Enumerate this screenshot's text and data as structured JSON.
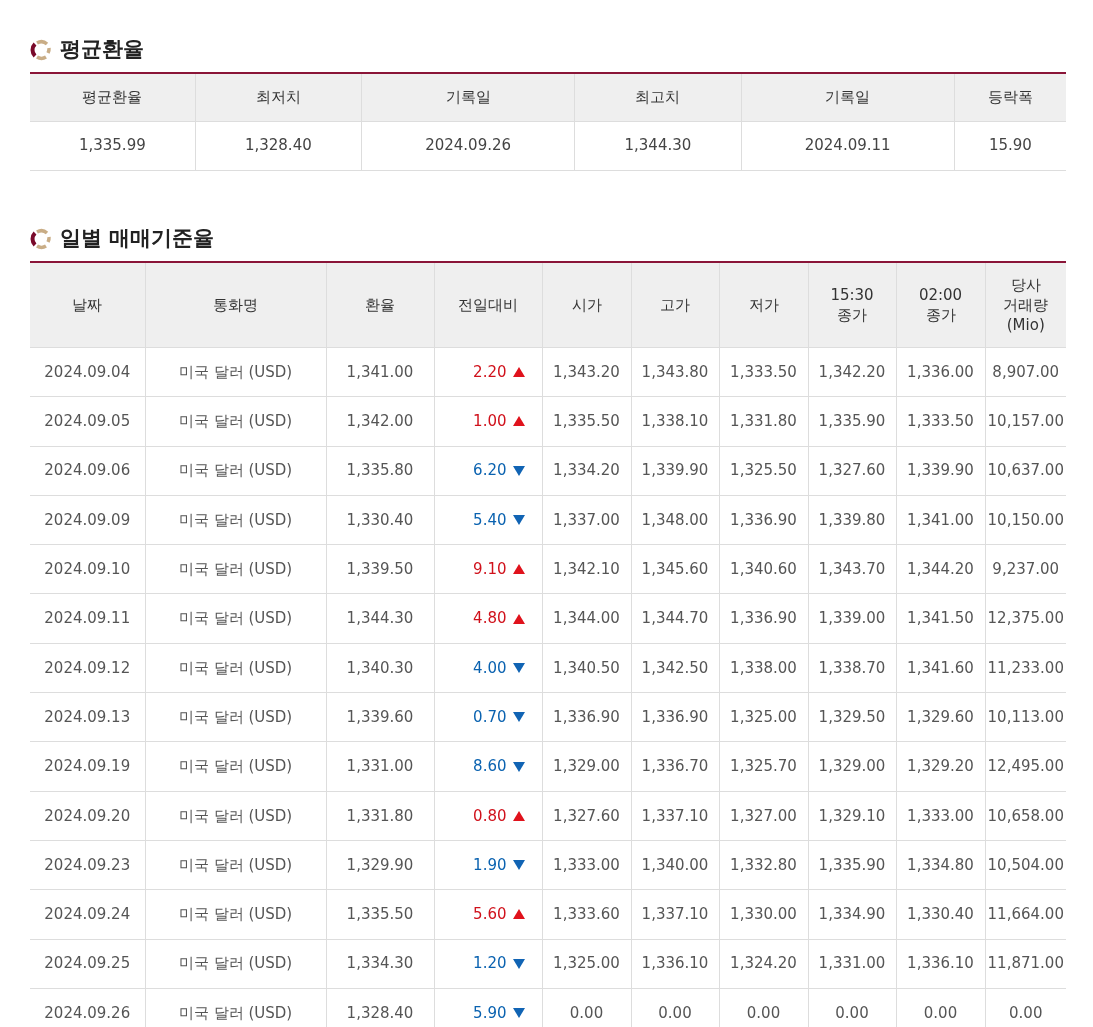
{
  "average_section": {
    "title": "평균환율",
    "columns": [
      "평균환율",
      "최저치",
      "기록일",
      "최고치",
      "기록일",
      "등락폭"
    ],
    "row": [
      "1,335.99",
      "1,328.40",
      "2024.09.26",
      "1,344.30",
      "2024.09.11",
      "15.90"
    ]
  },
  "daily_section": {
    "title": "일별 매매기준율",
    "columns": [
      "날짜",
      "통화명",
      "환율",
      "전일대비",
      "시가",
      "고가",
      "저가",
      "15:30\n종가",
      "02:00\n종가",
      "당사\n거래량\n(Mio)"
    ],
    "rows": [
      {
        "date": "2024.09.04",
        "currency": "미국 달러 (USD)",
        "rate": "1,341.00",
        "change": "2.20",
        "kind": "up",
        "open": "1,343.20",
        "high": "1,343.80",
        "low": "1,333.50",
        "close_1530": "1,342.20",
        "close_0200": "1,336.00",
        "volume": "8,907.00"
      },
      {
        "date": "2024.09.05",
        "currency": "미국 달러 (USD)",
        "rate": "1,342.00",
        "change": "1.00",
        "kind": "up",
        "open": "1,335.50",
        "high": "1,338.10",
        "low": "1,331.80",
        "close_1530": "1,335.90",
        "close_0200": "1,333.50",
        "volume": "10,157.00"
      },
      {
        "date": "2024.09.06",
        "currency": "미국 달러 (USD)",
        "rate": "1,335.80",
        "change": "6.20",
        "kind": "down",
        "open": "1,334.20",
        "high": "1,339.90",
        "low": "1,325.50",
        "close_1530": "1,327.60",
        "close_0200": "1,339.90",
        "volume": "10,637.00"
      },
      {
        "date": "2024.09.09",
        "currency": "미국 달러 (USD)",
        "rate": "1,330.40",
        "change": "5.40",
        "kind": "down",
        "open": "1,337.00",
        "high": "1,348.00",
        "low": "1,336.90",
        "close_1530": "1,339.80",
        "close_0200": "1,341.00",
        "volume": "10,150.00"
      },
      {
        "date": "2024.09.10",
        "currency": "미국 달러 (USD)",
        "rate": "1,339.50",
        "change": "9.10",
        "kind": "up",
        "open": "1,342.10",
        "high": "1,345.60",
        "low": "1,340.60",
        "close_1530": "1,343.70",
        "close_0200": "1,344.20",
        "volume": "9,237.00"
      },
      {
        "date": "2024.09.11",
        "currency": "미국 달러 (USD)",
        "rate": "1,344.30",
        "change": "4.80",
        "kind": "up",
        "open": "1,344.00",
        "high": "1,344.70",
        "low": "1,336.90",
        "close_1530": "1,339.00",
        "close_0200": "1,341.50",
        "volume": "12,375.00"
      },
      {
        "date": "2024.09.12",
        "currency": "미국 달러 (USD)",
        "rate": "1,340.30",
        "change": "4.00",
        "kind": "down",
        "open": "1,340.50",
        "high": "1,342.50",
        "low": "1,338.00",
        "close_1530": "1,338.70",
        "close_0200": "1,341.60",
        "volume": "11,233.00"
      },
      {
        "date": "2024.09.13",
        "currency": "미국 달러 (USD)",
        "rate": "1,339.60",
        "change": "0.70",
        "kind": "down",
        "open": "1,336.90",
        "high": "1,336.90",
        "low": "1,325.00",
        "close_1530": "1,329.50",
        "close_0200": "1,329.60",
        "volume": "10,113.00"
      },
      {
        "date": "2024.09.19",
        "currency": "미국 달러 (USD)",
        "rate": "1,331.00",
        "change": "8.60",
        "kind": "down",
        "open": "1,329.00",
        "high": "1,336.70",
        "low": "1,325.70",
        "close_1530": "1,329.00",
        "close_0200": "1,329.20",
        "volume": "12,495.00"
      },
      {
        "date": "2024.09.20",
        "currency": "미국 달러 (USD)",
        "rate": "1,331.80",
        "change": "0.80",
        "kind": "up",
        "open": "1,327.60",
        "high": "1,337.10",
        "low": "1,327.00",
        "close_1530": "1,329.10",
        "close_0200": "1,333.00",
        "volume": "10,658.00"
      },
      {
        "date": "2024.09.23",
        "currency": "미국 달러 (USD)",
        "rate": "1,329.90",
        "change": "1.90",
        "kind": "down",
        "open": "1,333.00",
        "high": "1,340.00",
        "low": "1,332.80",
        "close_1530": "1,335.90",
        "close_0200": "1,334.80",
        "volume": "10,504.00"
      },
      {
        "date": "2024.09.24",
        "currency": "미국 달러 (USD)",
        "rate": "1,335.50",
        "change": "5.60",
        "kind": "up",
        "open": "1,333.60",
        "high": "1,337.10",
        "low": "1,330.00",
        "close_1530": "1,334.90",
        "close_0200": "1,330.40",
        "volume": "11,664.00"
      },
      {
        "date": "2024.09.25",
        "currency": "미국 달러 (USD)",
        "rate": "1,334.30",
        "change": "1.20",
        "kind": "down",
        "open": "1,325.00",
        "high": "1,336.10",
        "low": "1,324.20",
        "close_1530": "1,331.00",
        "close_0200": "1,336.10",
        "volume": "11,871.00"
      },
      {
        "date": "2024.09.26",
        "currency": "미국 달러 (USD)",
        "rate": "1,328.40",
        "change": "5.90",
        "kind": "down",
        "open": "0.00",
        "high": "0.00",
        "low": "0.00",
        "close_1530": "0.00",
        "close_0200": "0.00",
        "volume": "0.00"
      }
    ]
  }
}
